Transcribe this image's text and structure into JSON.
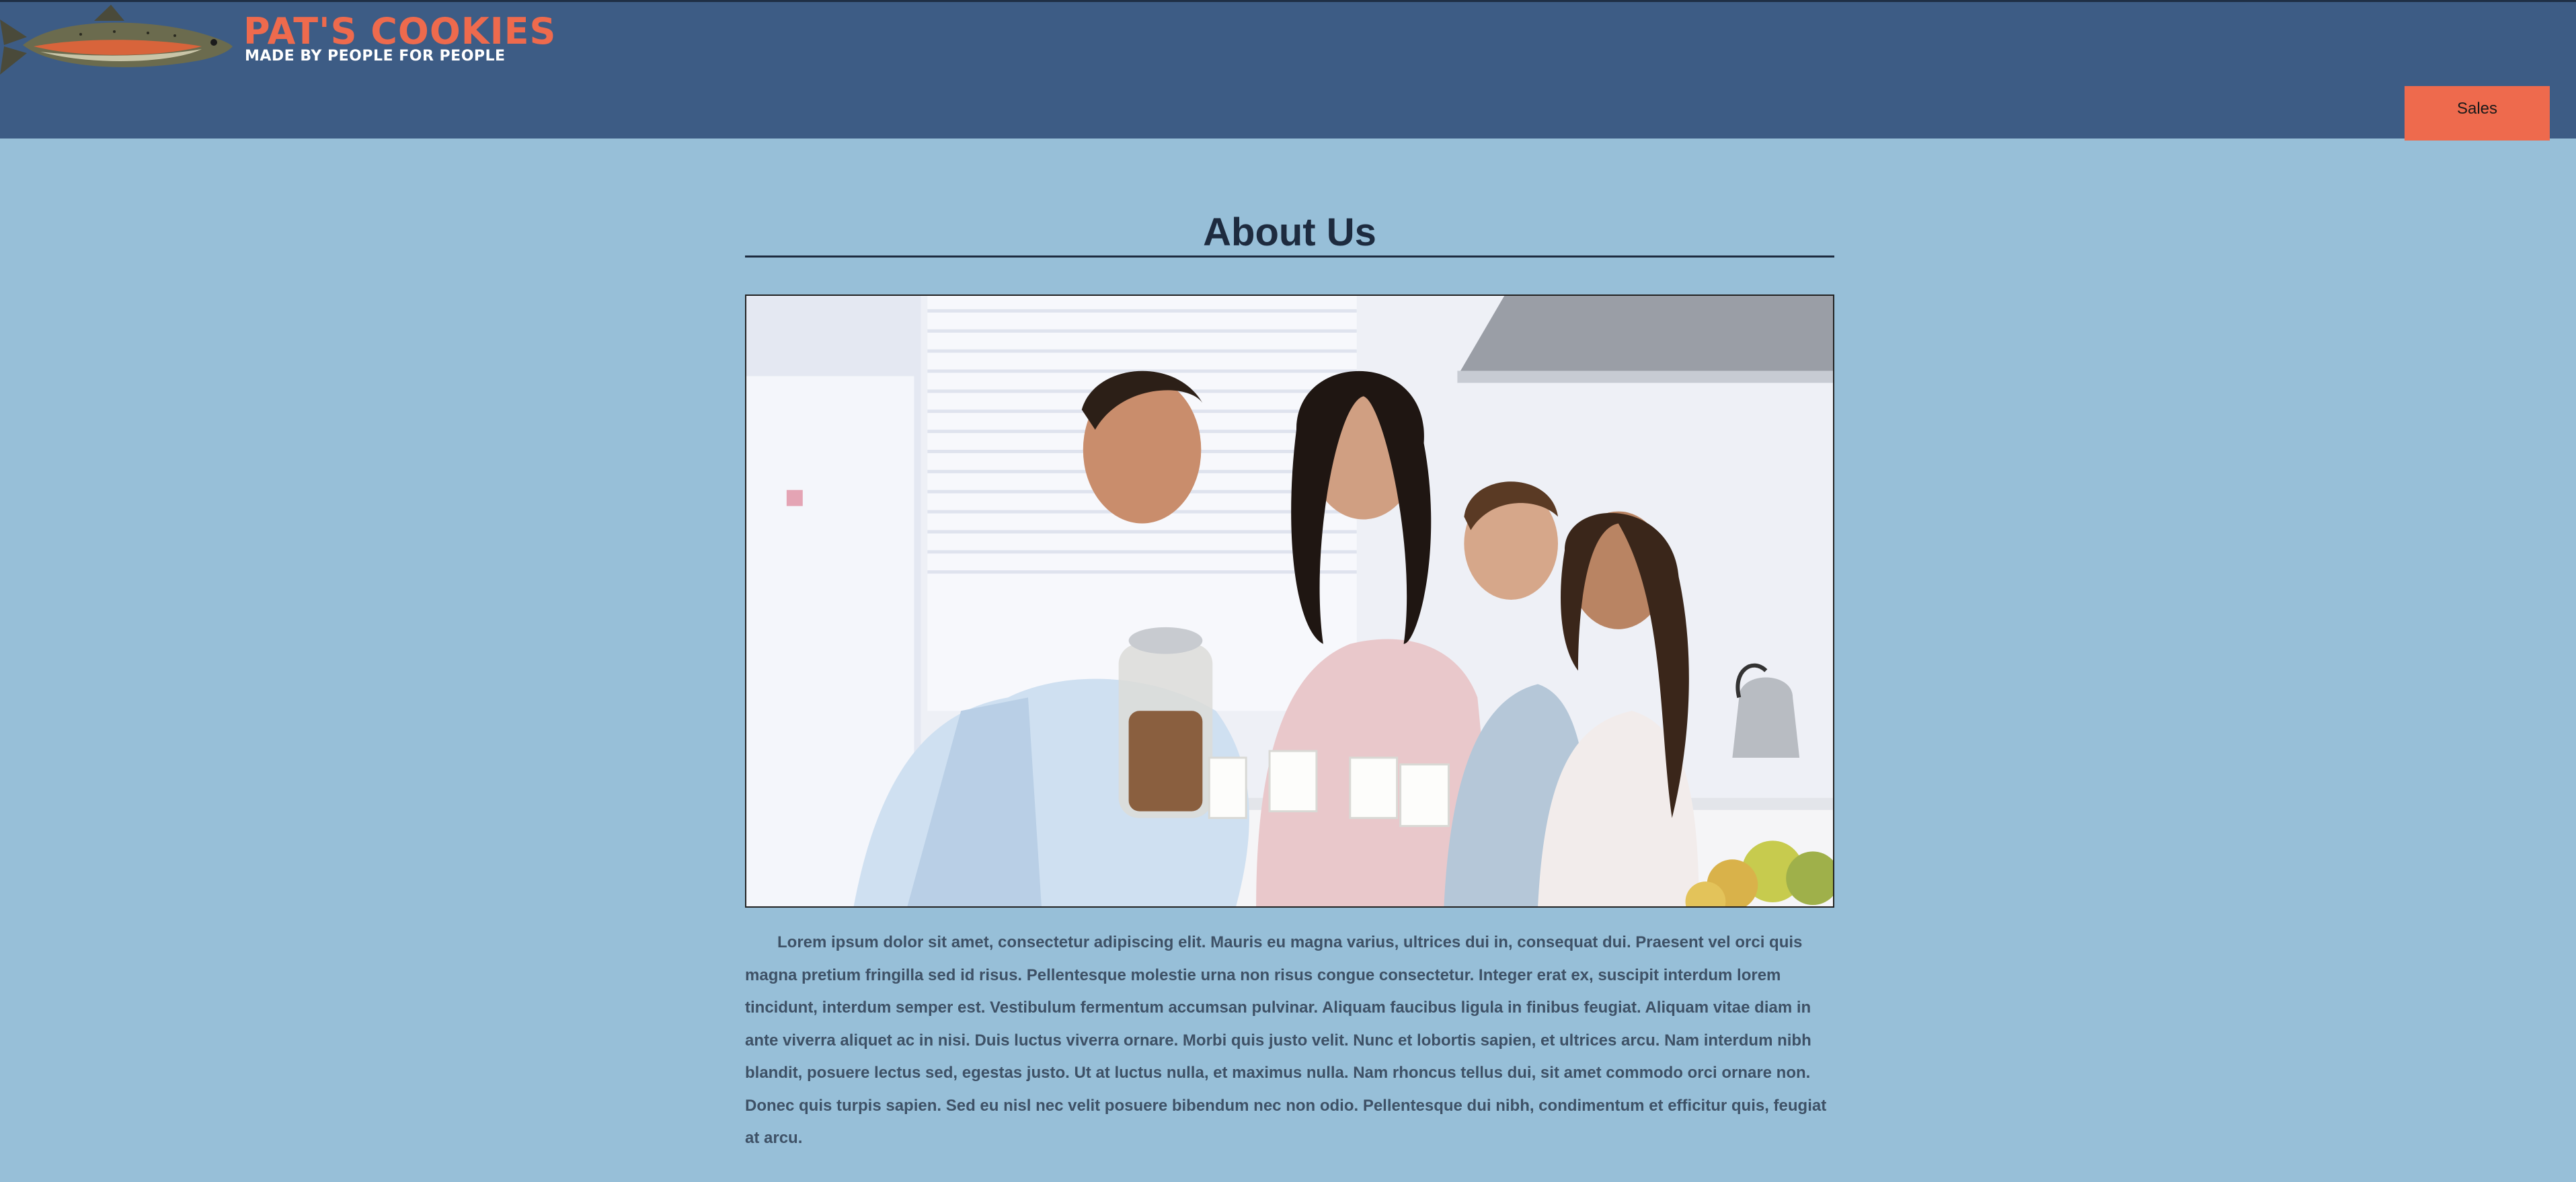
{
  "header": {
    "logo_icon": "salmon-fish-icon",
    "brand_name": "PAT'S COOKIES",
    "tagline": "MADE BY PEOPLE FOR PEOPLE",
    "nav": [
      {
        "label": "Sales"
      }
    ]
  },
  "main": {
    "title": "About Us",
    "photo_icon": "family-kitchen-photo",
    "paragraph": "Lorem ipsum dolor sit amet, consectetur adipiscing elit. Mauris eu magna varius, ultrices dui in, consequat dui. Praesent vel orci quis magna pretium fringilla sed id risus. Pellentesque molestie urna non risus congue consectetur. Integer erat ex, suscipit interdum lorem tincidunt, interdum semper est. Vestibulum fermentum accumsan pulvinar. Aliquam faucibus ligula in finibus feugiat. Aliquam vitae diam in ante viverra aliquet ac in nisi. Duis luctus viverra ornare. Morbi quis justo velit. Nunc et lobortis sapien, et ultrices arcu. Nam interdum nibh blandit, posuere lectus sed, egestas justo. Ut at luctus nulla, et maximus nulla. Nam rhoncus tellus dui, sit amet commodo orci ornare non. Donec quis turpis sapien. Sed eu nisl nec velit posuere bibendum nec non odio. Pellentesque dui nibh, condimentum et efficitur quis, feugiat at arcu."
  },
  "colors": {
    "header_bg": "#3d5c85",
    "page_bg": "#97bfd8",
    "accent": "#ee6a4d",
    "title": "#1d2b3f",
    "body_text": "#3e5166"
  }
}
